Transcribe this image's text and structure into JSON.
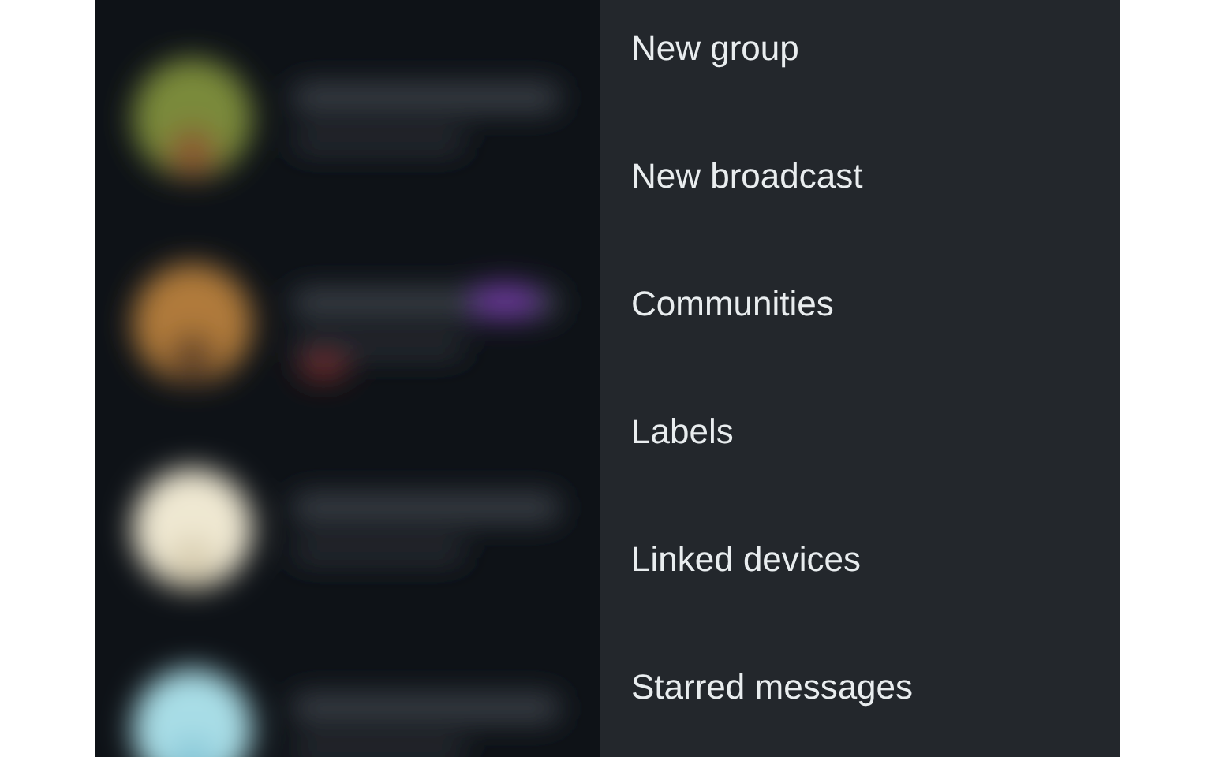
{
  "menu": {
    "items": [
      {
        "label": "New group"
      },
      {
        "label": "New broadcast"
      },
      {
        "label": "Communities"
      },
      {
        "label": "Labels"
      },
      {
        "label": "Linked devices"
      },
      {
        "label": "Starred messages"
      }
    ]
  }
}
